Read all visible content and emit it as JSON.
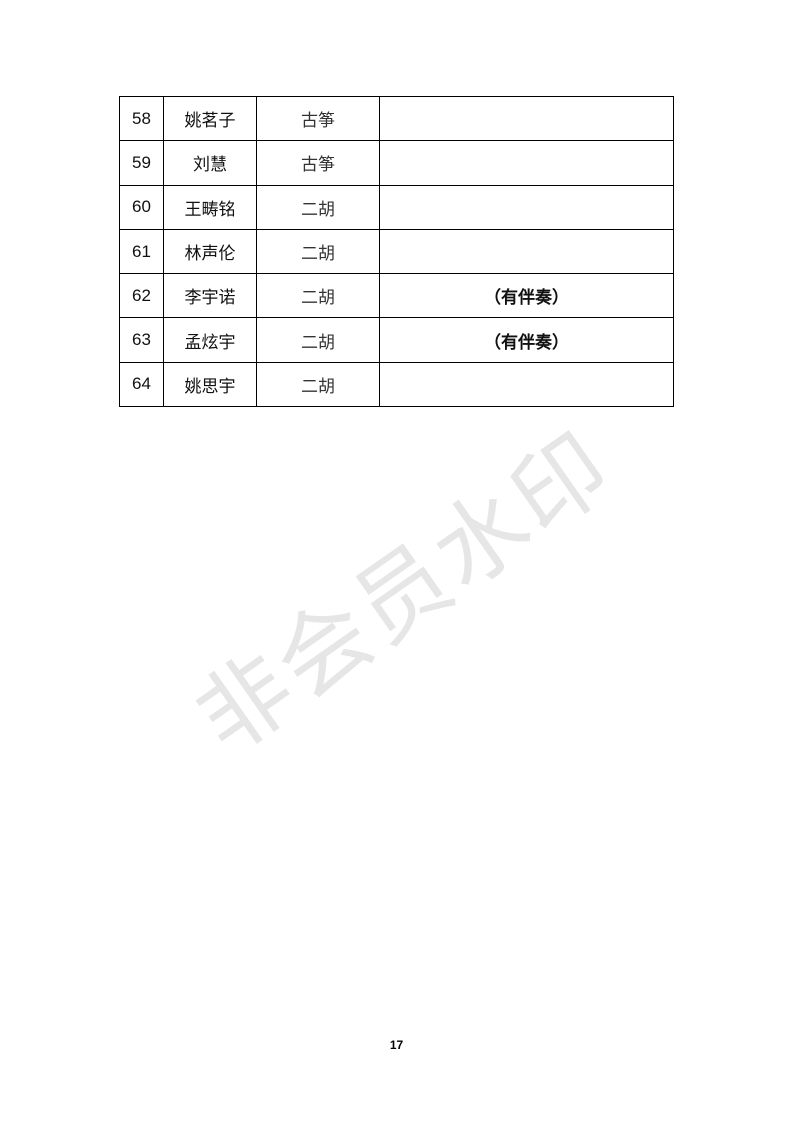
{
  "rows": [
    {
      "num": "58",
      "name": "姚茗子",
      "instrument": "古筝",
      "note": ""
    },
    {
      "num": "59",
      "name": "刘慧",
      "instrument": "古筝",
      "note": ""
    },
    {
      "num": "60",
      "name": "王畴铭",
      "instrument": "二胡",
      "note": ""
    },
    {
      "num": "61",
      "name": "林声伦",
      "instrument": "二胡",
      "note": ""
    },
    {
      "num": "62",
      "name": "李宇诺",
      "instrument": "二胡",
      "note": "（有伴奏）"
    },
    {
      "num": "63",
      "name": "孟炫宇",
      "instrument": "二胡",
      "note": "（有伴奏）"
    },
    {
      "num": "64",
      "name": "姚思宇",
      "instrument": "二胡",
      "note": ""
    }
  ],
  "watermark": "非会员水印",
  "page_number": "17"
}
